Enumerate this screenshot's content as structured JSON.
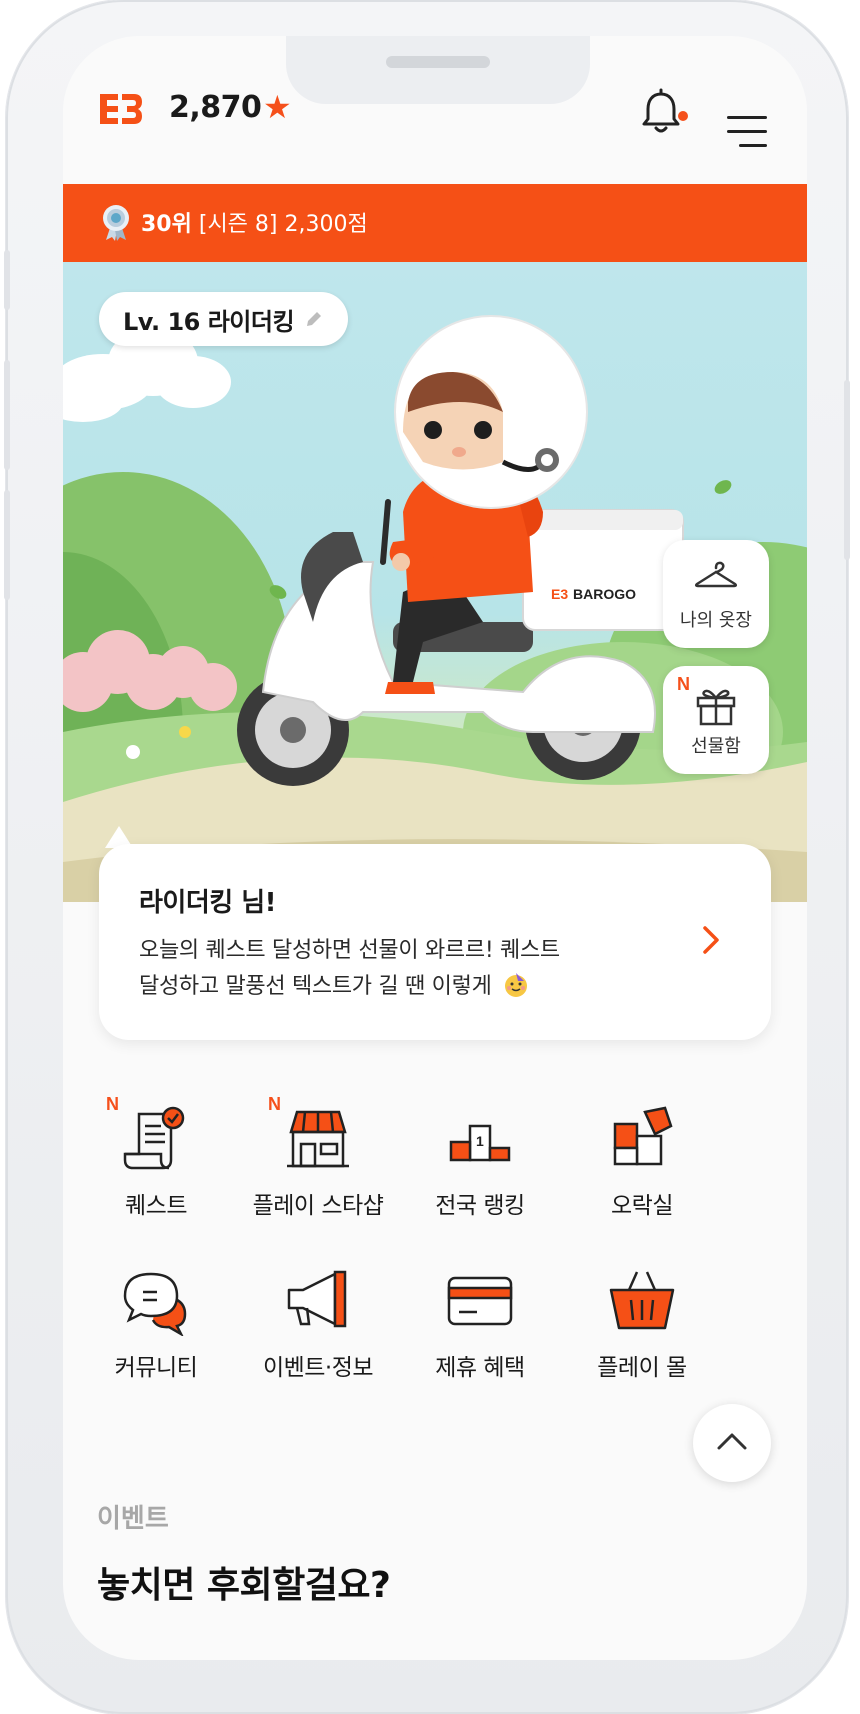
{
  "header": {
    "points": "2,870",
    "star_glyph": "★",
    "icons": [
      "barogo-logo",
      "star-icon",
      "bell-icon",
      "hamburger-menu-icon"
    ]
  },
  "rank": {
    "rank_label": "30위",
    "season_label": "[시즌 8] 2,300점"
  },
  "hero": {
    "level_label": "Lv. 16 라이더킹",
    "box_brand": "BAROGO",
    "closet_label": "나의 옷장",
    "giftbox_label": "선물함",
    "giftbox_new": "N"
  },
  "bubble": {
    "title": "라이더킹 님!",
    "line1": "오늘의 퀘스트 달성하면 선물이 와르르! 퀘스트",
    "line2": "달성하고 말풍선 텍스트가 길 땐 이렇게"
  },
  "menu": [
    {
      "label": "퀘스트",
      "new": "N",
      "icon": "quest-scroll-icon"
    },
    {
      "label": "플레이 스타샵",
      "new": "N",
      "icon": "shop-icon"
    },
    {
      "label": "전국 랭킹",
      "new": "",
      "icon": "podium-icon"
    },
    {
      "label": "오락실",
      "new": "",
      "icon": "puzzle-icon"
    },
    {
      "label": "커뮤니티",
      "new": "",
      "icon": "chat-icon"
    },
    {
      "label": "이벤트·정보",
      "new": "",
      "icon": "megaphone-icon"
    },
    {
      "label": "제휴 혜택",
      "new": "",
      "icon": "card-icon"
    },
    {
      "label": "플레이 몰",
      "new": "",
      "icon": "basket-icon"
    }
  ],
  "section": {
    "label": "이벤트",
    "title": "놓치면 후회할걸요?"
  },
  "colors": {
    "brand": "#f55016",
    "text": "#1a1a1a",
    "muted": "#a7a7a7"
  }
}
